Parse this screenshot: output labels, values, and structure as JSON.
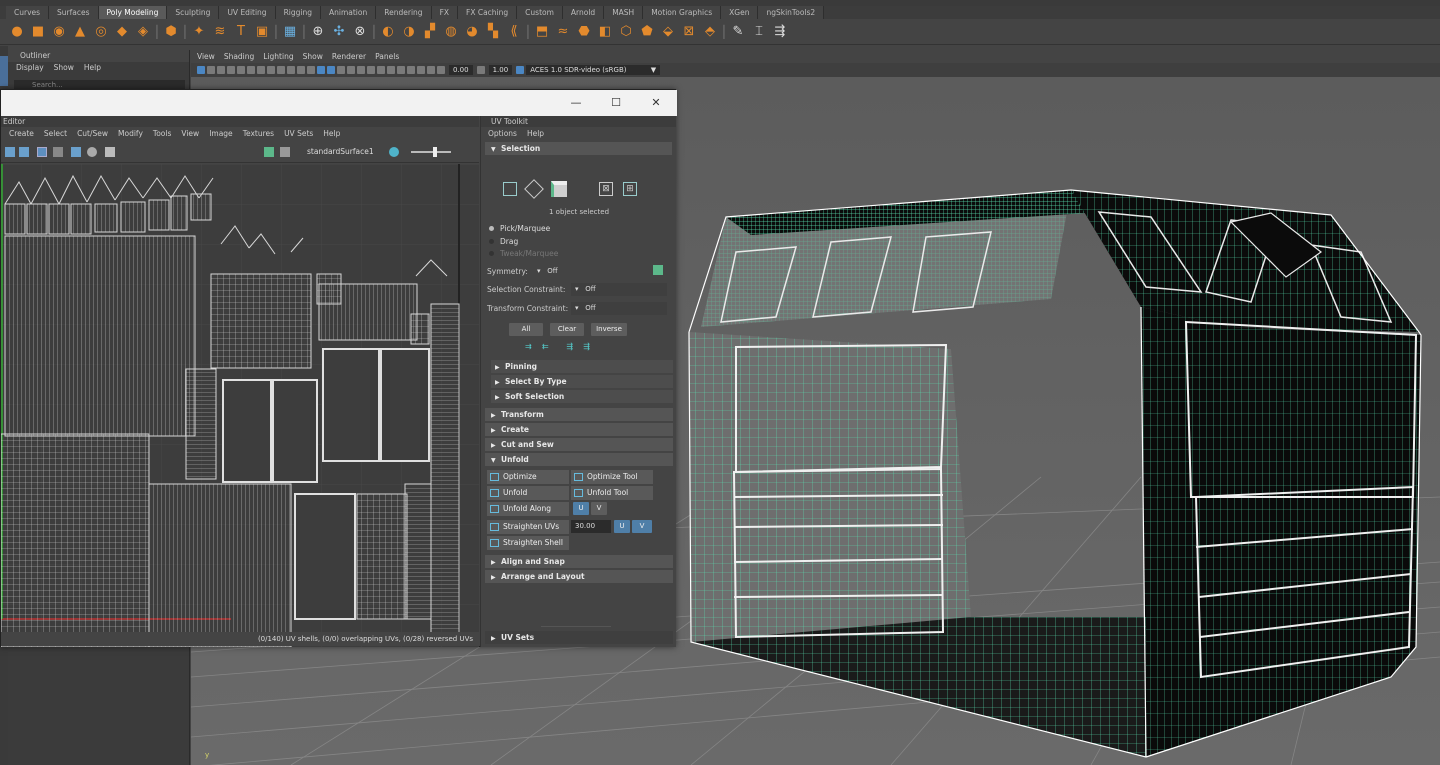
{
  "shelf": {
    "tabs": [
      "Curves",
      "Surfaces",
      "Poly Modeling",
      "Sculpting",
      "UV Editing",
      "Rigging",
      "Animation",
      "Rendering",
      "FX",
      "FX Caching",
      "Custom",
      "Arnold",
      "MASH",
      "Motion Graphics",
      "XGen",
      "ngSkinTools2"
    ],
    "active_tab": "Poly Modeling"
  },
  "outliner": {
    "title": "Outliner",
    "menu": [
      "Display",
      "Show",
      "Help"
    ],
    "search_placeholder": "Search..."
  },
  "viewport": {
    "menu": [
      "View",
      "Shading",
      "Lighting",
      "Show",
      "Renderer",
      "Panels"
    ],
    "exposure": "0.00",
    "gamma": "1.00",
    "color_space": "ACES 1.0 SDR-video (sRGB)"
  },
  "uv_editor": {
    "caption": "Editor",
    "menu": [
      "Create",
      "Select",
      "Cut/Sew",
      "Modify",
      "Tools",
      "View",
      "Image",
      "Textures",
      "UV Sets",
      "Help"
    ],
    "surface": "standardSurface1",
    "status": "(0/140) UV shells, (0/0) overlapping UVs, (0/28) reversed UVs"
  },
  "uv_toolkit": {
    "title": "UV Toolkit",
    "menu": [
      "Options",
      "Help"
    ],
    "selection_header": "Selection",
    "selected_count": "1 object selected",
    "modes": [
      "Pick/Marquee",
      "Drag",
      "Tweak/Marquee"
    ],
    "symmetry_label": "Symmetry:",
    "symmetry_value": "Off",
    "selection_constraint_label": "Selection Constraint:",
    "selection_constraint_value": "Off",
    "transform_constraint_label": "Transform Constraint:",
    "transform_constraint_value": "Off",
    "buttons": {
      "all": "All",
      "clear": "Clear",
      "inverse": "Inverse"
    },
    "sub_sections": [
      "Pinning",
      "Select By Type",
      "Soft Selection"
    ],
    "sections": [
      "Transform",
      "Create",
      "Cut and Sew",
      "Unfold"
    ],
    "unfold": {
      "optimize": "Optimize",
      "optimize_tool": "Optimize Tool",
      "unfold": "Unfold",
      "unfold_tool": "Unfold Tool",
      "unfold_along": "Unfold Along",
      "u": "U",
      "v": "V",
      "straighten_uvs": "Straighten UVs",
      "straighten_value": "30.00",
      "straighten_shell": "Straighten Shell"
    },
    "bottom_sections": [
      "Align and Snap",
      "Arrange and Layout"
    ],
    "uv_sets": "UV Sets"
  }
}
